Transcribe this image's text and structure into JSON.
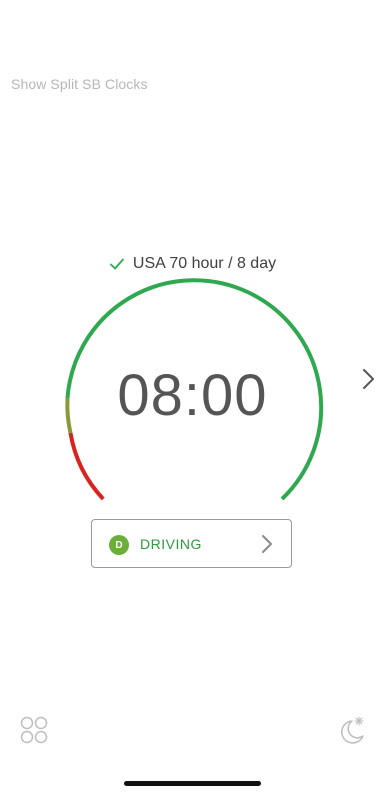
{
  "header": {
    "split_sb_label": "Show Split SB Clocks"
  },
  "ruleset": {
    "label": "USA 70 hour / 8 day",
    "status": "selected"
  },
  "clock": {
    "time": "08:00"
  },
  "duty_status": {
    "badge": "D",
    "label": "DRIVING"
  },
  "colors": {
    "accent_green": "#2fa84f",
    "warning_olive": "#8a9a3a",
    "danger_red": "#d9231f",
    "driving_badge": "#6cae3a"
  },
  "icons": {
    "ruleset_check": "check-icon",
    "next": "chevron-right-icon",
    "status_arrow": "chevron-right-icon",
    "apps": "apps-grid-icon",
    "night_mode": "moon-star-icon"
  }
}
